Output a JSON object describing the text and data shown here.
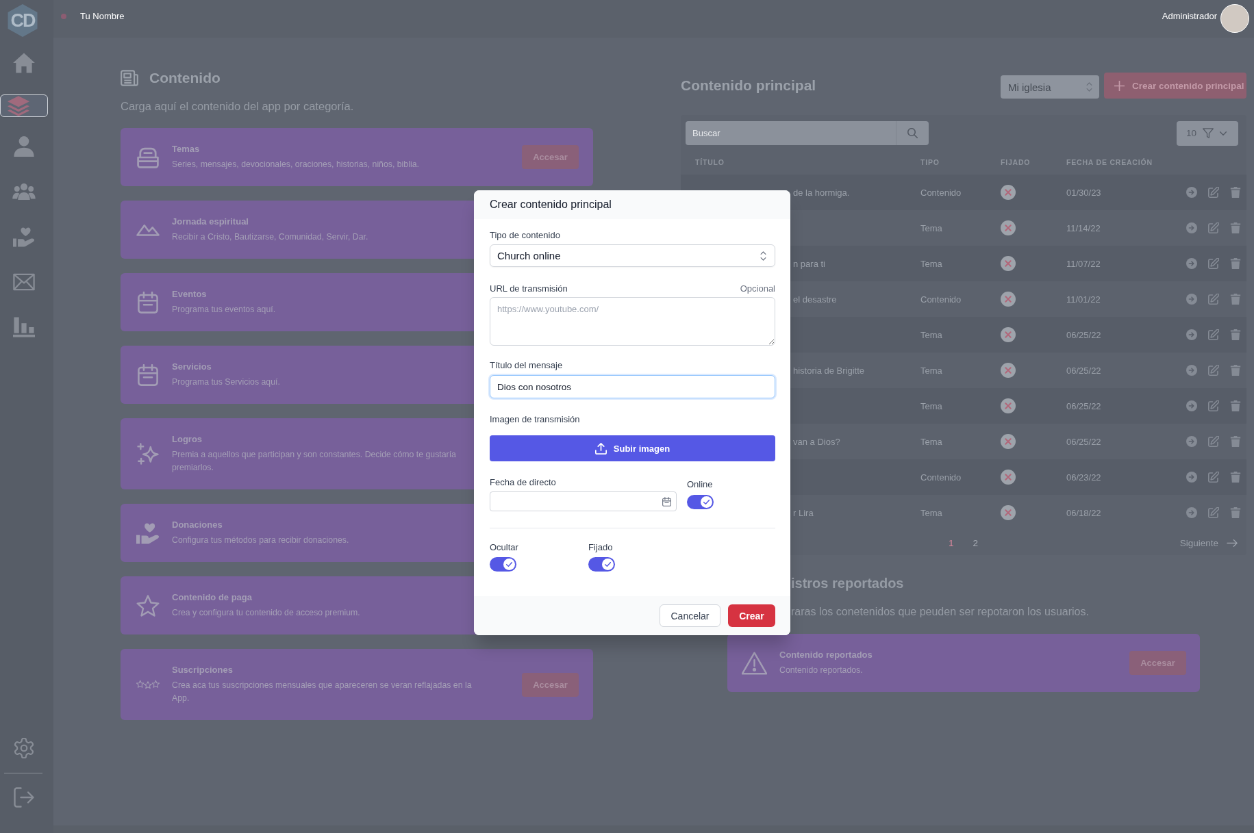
{
  "sidebar": {
    "logo": "CD",
    "items": [
      {
        "selected": false
      },
      {
        "selected": true
      },
      {
        "selected": false
      },
      {
        "selected": false
      },
      {
        "selected": false
      },
      {
        "selected": false
      },
      {
        "selected": false
      }
    ]
  },
  "top_bar": {
    "user_name": "Tu Nombre",
    "role": "Administrador"
  },
  "content": {
    "title": "Contenido",
    "subtitle": "Carga aquí el contenido del app por categoría.",
    "cards": [
      {
        "title": "Temas",
        "description": "Series, mensajes, devocionales, oraciones, historias, niños, biblia.",
        "button": "Accesar"
      },
      {
        "title": "Jornada espiritual",
        "description": "Recibir a Cristo, Bautizarse, Comunidad, Servir, Dar."
      },
      {
        "title": "Eventos",
        "description": "Programa tus eventos aquí."
      },
      {
        "title": "Servicios",
        "description": "Programa tus Servicios aquí."
      },
      {
        "title": "Logros",
        "description": "Premia a aquellos que participan y son constantes. Decide cómo te gustaría premiarlos."
      },
      {
        "title": "Donaciones",
        "description": "Configura tus métodos para recibir donaciones."
      },
      {
        "title": "Contenido de paga",
        "description": "Crea y configura tu contenido de acceso premium."
      },
      {
        "title": "Suscripciones",
        "description": "Crea aca tus suscripciones mensuales que apareceren se veran reflajadas en la App.",
        "button": "Accesar"
      }
    ]
  },
  "main_content": {
    "title": "Contenido principal",
    "church_select": {
      "value": "Mi iglesia"
    },
    "create_button": "Crear contenido principal",
    "search": {
      "placeholder": "Buscar"
    },
    "page_size": "10",
    "table": {
      "columns": [
        "TÍTULO",
        "TIPO",
        "FIJADO",
        "FECHA DE CREACIÓN"
      ],
      "rows": [
        {
          "title": "de la hormiga.",
          "type": "Contenido",
          "pinned": false,
          "date": "01/30/23"
        },
        {
          "type": "Tema",
          "pinned": false,
          "date": "11/14/22"
        },
        {
          "title": "n para ti",
          "type": "Tema",
          "pinned": false,
          "date": "11/07/22"
        },
        {
          "title": "el desastre",
          "type": "Contenido",
          "pinned": false,
          "date": "11/01/22"
        },
        {
          "type": "Tema",
          "pinned": false,
          "date": "06/25/22"
        },
        {
          "title": "historia de Brigitte",
          "type": "Tema",
          "pinned": false,
          "date": "06/25/22"
        },
        {
          "type": "Tema",
          "pinned": false,
          "date": "06/25/22"
        },
        {
          "title": "van a Dios?",
          "type": "Tema",
          "pinned": false,
          "date": "06/25/22"
        },
        {
          "type": "Contenido",
          "pinned": false,
          "date": "06/23/22"
        },
        {
          "title": "r Lira",
          "type": "Tema",
          "pinned": false,
          "date": "06/18/22"
        }
      ]
    },
    "pagination": {
      "pages": [
        {
          "label": "1",
          "selected": true
        },
        {
          "label": "2",
          "selected": false
        }
      ],
      "next": "Siguiente"
    }
  },
  "reports": {
    "title": "istros reportados",
    "subtitle": "raras los conetenidos que peuden ser repotaron los usuarios.",
    "card": {
      "title": "Contenido reportados",
      "description": "Contenido reportados.",
      "button": "Accesar"
    }
  },
  "modal": {
    "title": "Crear contenido principal",
    "content_type": {
      "label": "Tipo de contenido",
      "value": "Church online"
    },
    "url": {
      "label": "URL de transmisión",
      "optional_label": "Opcional",
      "placeholder": "https://www.youtube.com/"
    },
    "message_title": {
      "label": "Título del mensaje",
      "value": "Dios con nosotros",
      "focused": true
    },
    "image": {
      "label": "Imagen de transmisión",
      "button": "Subir imagen"
    },
    "live_date": {
      "label": "Fecha de directo"
    },
    "online": {
      "label": "Online",
      "on": true
    },
    "hidden": {
      "label": "Ocultar",
      "on": true
    },
    "pinned": {
      "label": "Fijado",
      "on": true
    },
    "cancel": "Cancelar",
    "create": "Crear"
  }
}
